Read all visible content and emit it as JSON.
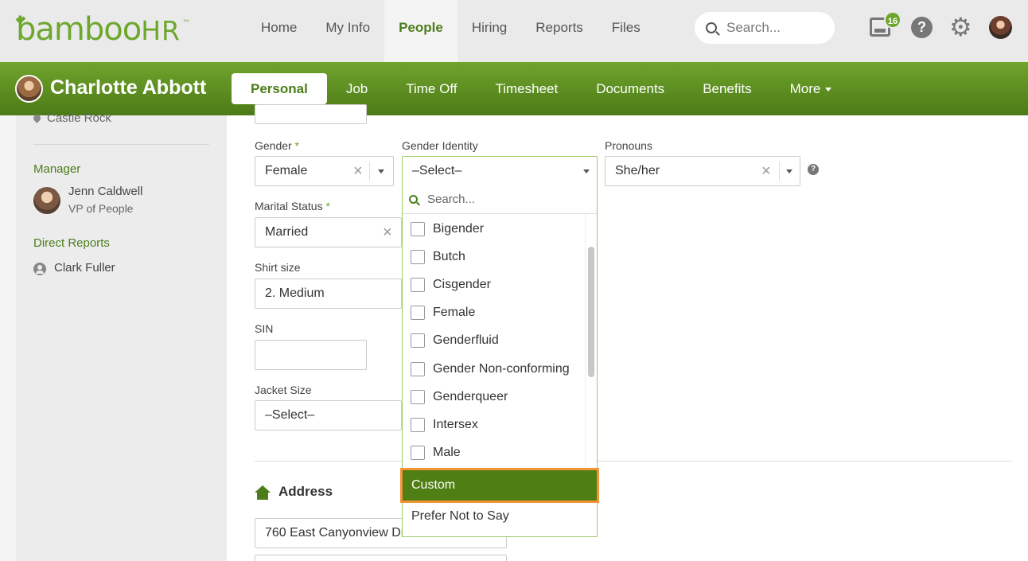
{
  "topnav": {
    "logo": {
      "text_main": "bamboo",
      "text_hr": "HR",
      "tm": "™"
    },
    "links": [
      "Home",
      "My Info",
      "People",
      "Hiring",
      "Reports",
      "Files"
    ],
    "active_link": "People",
    "search_placeholder": "Search...",
    "inbox_count": "16",
    "help_label": "?"
  },
  "employee": {
    "name": "Charlotte Abbott",
    "tabs": [
      "Personal",
      "Job",
      "Time Off",
      "Timesheet",
      "Documents",
      "Benefits",
      "More"
    ],
    "active_tab": "Personal"
  },
  "sidebar": {
    "location": "Castle Rock",
    "manager_heading": "Manager",
    "manager_name": "Jenn Caldwell",
    "manager_title": "VP of People",
    "direct_reports_heading": "Direct Reports",
    "direct_report": "Clark Fuller"
  },
  "form": {
    "gender_label": "Gender",
    "gender_value": "Female",
    "gender_identity_label": "Gender Identity",
    "gender_identity_value": "–Select–",
    "pronouns_label": "Pronouns",
    "pronouns_value": "She/her",
    "marital_label": "Marital Status",
    "marital_value": "Married",
    "shirt_label": "Shirt size",
    "shirt_value": "2. Medium",
    "sin_label": "SIN",
    "sin_value": "",
    "jacket_label": "Jacket Size",
    "jacket_value": "–Select–",
    "required_mark": "*",
    "address_heading": "Address",
    "address_line1": "760 East Canyonview Drive"
  },
  "dropdown": {
    "search_placeholder": "Search...",
    "options": [
      "Bigender",
      "Butch",
      "Cisgender",
      "Female",
      "Genderfluid",
      "Gender Non-conforming",
      "Genderqueer",
      "Intersex",
      "Male"
    ],
    "highlighted": "Custom",
    "last_option": "Prefer Not to Say"
  },
  "colors": {
    "brand_green": "#6da72c",
    "dark_green": "#4b7d1a",
    "highlight_border": "#f29436"
  }
}
